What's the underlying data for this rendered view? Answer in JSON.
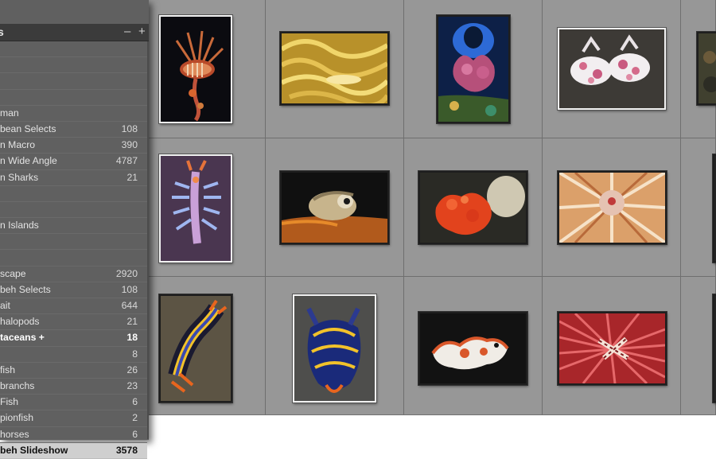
{
  "panel": {
    "title": "s",
    "minus": "–",
    "plus": "+",
    "rows": [
      {
        "label": "",
        "count": ""
      },
      {
        "label": "",
        "count": ""
      },
      {
        "label": "",
        "count": ""
      },
      {
        "label": "",
        "count": ""
      },
      {
        "label": "man",
        "count": ""
      },
      {
        "label": "bean Selects",
        "count": "108"
      },
      {
        "label": "n Macro",
        "count": "390"
      },
      {
        "label": "n Wide Angle",
        "count": "4787"
      },
      {
        "label": "n Sharks",
        "count": "21"
      },
      {
        "label": "",
        "count": ""
      },
      {
        "label": "",
        "count": ""
      },
      {
        "label": "n Islands",
        "count": ""
      },
      {
        "label": "",
        "count": ""
      },
      {
        "label": "",
        "count": ""
      },
      {
        "label": "scape",
        "count": "2920"
      },
      {
        "label": "beh Selects",
        "count": "108"
      },
      {
        "label": "ait",
        "count": "644"
      },
      {
        "label": "halopods",
        "count": "21"
      },
      {
        "label": "taceans  +",
        "count": "18",
        "bold": true
      },
      {
        "label": "",
        "count": "8"
      },
      {
        "label": "fish",
        "count": "26"
      },
      {
        "label": "branchs",
        "count": "23"
      },
      {
        "label": "Fish",
        "count": "6"
      },
      {
        "label": "pionfish",
        "count": "2"
      },
      {
        "label": "horses",
        "count": "6"
      },
      {
        "label": "beh Slideshow",
        "count": "3578",
        "selected": true
      }
    ]
  },
  "thumbnails": [
    {
      "subject": "lionfish",
      "orientation": "portrait",
      "frame": "light"
    },
    {
      "subject": "anemone-shrimp",
      "orientation": "landscape",
      "frame": "dark"
    },
    {
      "subject": "soft-coral",
      "orientation": "portrait",
      "frame": "dark"
    },
    {
      "subject": "harlequin-shrimp",
      "orientation": "landscape",
      "frame": "light"
    },
    {
      "subject": "partial",
      "orientation": "landscape",
      "frame": "dark"
    },
    {
      "subject": "nudibranch-purple",
      "orientation": "portrait",
      "frame": "light"
    },
    {
      "subject": "blenny",
      "orientation": "landscape",
      "frame": "dark"
    },
    {
      "subject": "orange-sponge",
      "orientation": "landscape",
      "frame": "dark"
    },
    {
      "subject": "urchin-shrimp",
      "orientation": "landscape",
      "frame": "dark"
    },
    {
      "subject": "partial",
      "orientation": "landscape",
      "frame": "dark"
    },
    {
      "subject": "nudibranch-striped",
      "orientation": "portrait",
      "frame": "dark"
    },
    {
      "subject": "nudibranch-blue-yellow",
      "orientation": "portrait",
      "frame": "light"
    },
    {
      "subject": "frogfish",
      "orientation": "landscape",
      "frame": "dark"
    },
    {
      "subject": "fire-urchin",
      "orientation": "landscape",
      "frame": "dark"
    },
    {
      "subject": "partial",
      "orientation": "landscape",
      "frame": "dark"
    }
  ],
  "colors": {
    "panel_bg": "#606060",
    "header_bg": "#3b3b3b",
    "grid_bg": "#979797",
    "selected_row": "#cfcfcf"
  }
}
